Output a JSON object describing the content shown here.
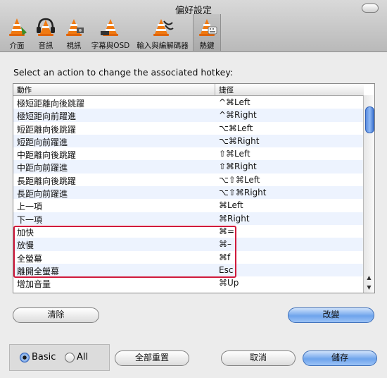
{
  "window": {
    "title": "偏好設定"
  },
  "toolbar": {
    "items": [
      {
        "label": "介面",
        "icon": "cone-interface-icon"
      },
      {
        "label": "音訊",
        "icon": "cone-headphones-icon"
      },
      {
        "label": "視訊",
        "icon": "cone-video-icon"
      },
      {
        "label": "字幕與OSD",
        "icon": "cone-subtitles-icon"
      },
      {
        "label": "輸入與編解碼器",
        "icon": "cone-codecs-icon"
      },
      {
        "label": "熱鍵",
        "icon": "cone-hotkeys-icon"
      }
    ],
    "selected": "熱鍵"
  },
  "hotkeys": {
    "prompt": "Select an action to change the associated hotkey:",
    "col_action": "動作",
    "col_hotkey": "捷徑",
    "rows": [
      {
        "action": "極短距離向後跳躍",
        "hotkey": "^⌘Left"
      },
      {
        "action": "極短距向前躍進",
        "hotkey": "^⌘Right"
      },
      {
        "action": "短距離向後跳躍",
        "hotkey": "⌥⌘Left"
      },
      {
        "action": "短距向前躍進",
        "hotkey": "⌥⌘Right"
      },
      {
        "action": "中距離向後跳躍",
        "hotkey": "⇧⌘Left"
      },
      {
        "action": "中距向前躍進",
        "hotkey": "⇧⌘Right"
      },
      {
        "action": "長距離向後跳躍",
        "hotkey": "⌥⇧⌘Left"
      },
      {
        "action": "長距向前躍進",
        "hotkey": "⌥⇧⌘Right"
      },
      {
        "action": "上一項",
        "hotkey": "⌘Left"
      },
      {
        "action": "下一項",
        "hotkey": "⌘Right"
      },
      {
        "action": "加快",
        "hotkey": "⌘="
      },
      {
        "action": "放慢",
        "hotkey": "⌘–"
      },
      {
        "action": "全螢幕",
        "hotkey": "⌘f"
      },
      {
        "action": "離開全螢幕",
        "hotkey": "Esc"
      },
      {
        "action": "增加音量",
        "hotkey": "⌘Up"
      }
    ]
  },
  "buttons": {
    "clear": "清除",
    "change": "改變",
    "reset_all": "全部重置",
    "cancel": "取消",
    "save": "儲存"
  },
  "mode": {
    "basic": "Basic",
    "all": "All",
    "selected": "Basic"
  },
  "colors": {
    "accent": "#6ea4ec",
    "highlight": "#d01a3c"
  }
}
